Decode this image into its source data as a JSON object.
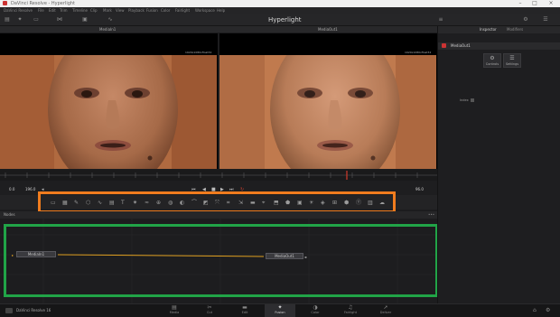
{
  "window": {
    "title": "DaVinci Resolve - Hyperlight"
  },
  "menubar": {
    "items": [
      "DaVinci Resolve",
      "File",
      "Edit",
      "Trim",
      "Timeline",
      "Clip",
      "Mark",
      "View",
      "Playback",
      "Fusion",
      "Color",
      "Fairlight",
      "Workspace",
      "Help"
    ]
  },
  "toolbar": {
    "app_name": "Hyperlight"
  },
  "viewer": {
    "left_label": "MediaIn1",
    "right_label": "MediaOut1",
    "left_info": "1920x1080xfloat32",
    "right_info": "1920x1080xfloat32"
  },
  "transport": {
    "start": "0.0",
    "current": "196.0",
    "end": "96.0"
  },
  "tools": {
    "icons": [
      "loader-icon",
      "bg-icon",
      "paint-icon",
      "polygon-icon",
      "bspline-icon",
      "bitmap-icon",
      "text-icon",
      "particles-icon",
      "fastnoise-icon",
      "merge-icon",
      "blur-icon",
      "color-corrector-icon",
      "curves-icon",
      "matte-icon",
      "transform-icon",
      "crop-icon",
      "resize-icon",
      "letterbox-icon",
      "tracker-icon",
      "planar-icon",
      "shape-icon",
      "camera-icon",
      "light-icon",
      "render3d-icon",
      "merge3d-icon",
      "shape3d-icon",
      "text3d-icon",
      "image-plane-icon",
      "fog-icon"
    ]
  },
  "nodes": {
    "header": "Nodes",
    "node_in": "MediaIn1",
    "node_out": "MediaOut1"
  },
  "inspector": {
    "tab_left": "Inspector",
    "tab_right": "Modifiers",
    "tool_name": "MediaOut1",
    "subtab_controls": "Controls",
    "subtab_settings": "Settings",
    "control_label": "Index"
  },
  "pagebar": {
    "brand": "DaVinci Resolve 16",
    "pages": [
      {
        "label": "Media",
        "icon": "media-icon",
        "active": false
      },
      {
        "label": "Cut",
        "icon": "cut-icon",
        "active": false
      },
      {
        "label": "Edit",
        "icon": "edit-icon",
        "active": false
      },
      {
        "label": "Fusion",
        "icon": "fusion-icon",
        "active": true
      },
      {
        "label": "Color",
        "icon": "color-icon",
        "active": false
      },
      {
        "label": "Fairlight",
        "icon": "fairlight-icon",
        "active": false
      },
      {
        "label": "Deliver",
        "icon": "deliver-icon",
        "active": false
      }
    ]
  },
  "colors": {
    "highlight_tools": "#f07c1e",
    "highlight_nodes": "#21a447",
    "background": "#1c1c1e"
  }
}
